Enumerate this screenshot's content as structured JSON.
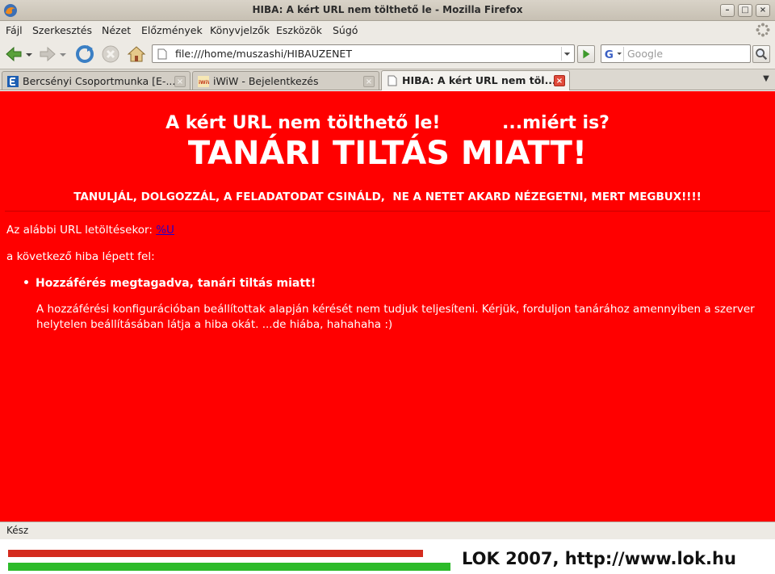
{
  "window": {
    "title": "HIBA: A kért URL nem tölthető le - Mozilla Firefox",
    "buttons": [
      "minimize",
      "maximize",
      "close"
    ]
  },
  "menu": {
    "items": [
      "Fájl",
      "Szerkesztés",
      "Nézet",
      "Előzmények",
      "Könyvjelzők",
      "Eszközök",
      "Súgó"
    ]
  },
  "navigation": {
    "url": "file:///home/muszashi/HIBAUZENET",
    "search_placeholder": "Google"
  },
  "tabs": [
    {
      "label": "Bercsényi Csoportmunka [E-...",
      "active": false
    },
    {
      "label": "iWiW - Bejelentkezés",
      "active": false
    },
    {
      "label": "HIBA: A kért URL nem töl...",
      "active": true
    }
  ],
  "page": {
    "heading_left": "A kért URL nem tölthető le!",
    "heading_right": "...miért is?",
    "headline": "TANÁRI TILTÁS MIATT!",
    "subheadline": "TANULJÁL, DOLGOZZÁL, A FELADATODAT CSINÁLD,  NE A NETET AKARD NÉZEGETNI, MERT MEGBUX!!!!",
    "url_line_prefix": "Az alábbi URL letöltésekor: ",
    "url_placeholder": "%U",
    "error_intro": "a következő hiba lépett fel:",
    "error_title": "Hozzáférés megtagadva, tanári tiltás miatt!",
    "error_detail": "A hozzáférési konfigurációban beállítottak alapján kérését nem tudjuk teljesíteni. Kérjük, forduljon tanárához amennyiben a szerver helytelen beállításában látja a hiba okát. ...de hiába, hahahaha :)"
  },
  "status": {
    "text": "Kész"
  },
  "footer": {
    "text": "LOK 2007, http://www.lok.hu"
  },
  "colors": {
    "page_background": "#ff0000",
    "text": "#ffffff",
    "link": "#2200cc",
    "footer_red_bar": "#d42b1e",
    "footer_green_bar": "#2dbb2a"
  }
}
